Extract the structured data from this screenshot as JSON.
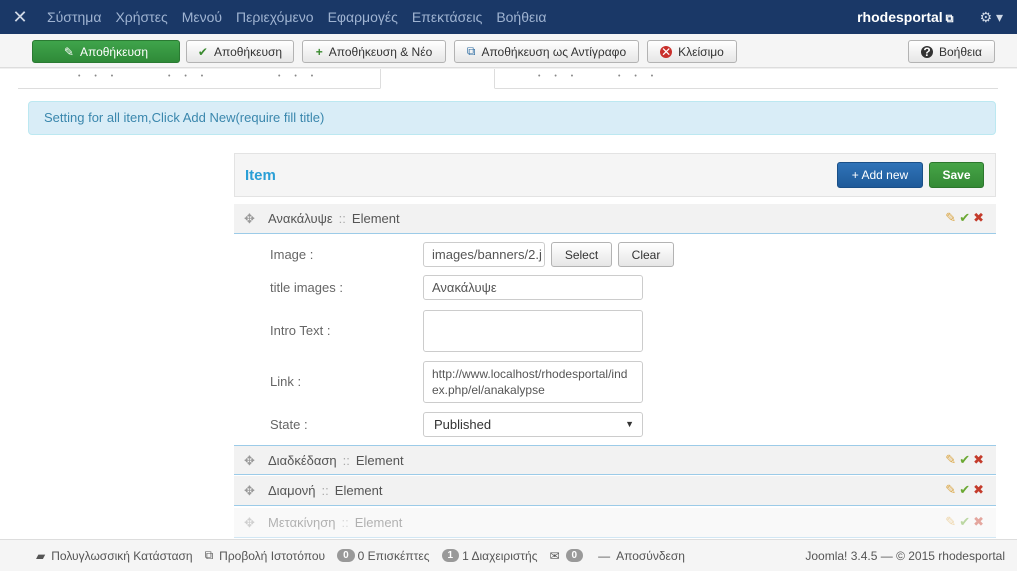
{
  "topbar": {
    "logo": "joomla-logo",
    "menu": [
      "Σύστημα",
      "Χρήστες",
      "Μενού",
      "Περιεχόμενο",
      "Εφαρμογές",
      "Επεκτάσεις",
      "Βοήθεια"
    ],
    "site_name": "rhodesportal",
    "external_icon": "external-link-icon",
    "settings_icon": "gear-icon"
  },
  "toolbar": {
    "save": "Αποθήκευση",
    "save_close": "Αποθήκευση",
    "save_new": "Αποθήκευση & Νέο",
    "save_copy": "Αποθήκευση ως Αντίγραφο",
    "close": "Κλείσιμο",
    "help": "Βοήθεια"
  },
  "alert": "Setting for all item,Click Add New(require fill title)",
  "panel": {
    "title": "Item",
    "add_new": "+ Add new",
    "save": "Save"
  },
  "items": [
    {
      "title": "Ανακάλυψε",
      "type": "Element",
      "sep": "::"
    },
    {
      "title": "Διαδκέδαση",
      "type": "Element",
      "sep": "::"
    },
    {
      "title": "Διαμονή",
      "type": "Element",
      "sep": "::"
    },
    {
      "title": "Μετακίνηση",
      "type": "Element",
      "sep": "::"
    }
  ],
  "form": {
    "image_label": "Image :",
    "image_value": "images/banners/2.j",
    "select_btn": "Select",
    "clear_btn": "Clear",
    "title_label": "title images :",
    "title_value": "Ανακάλυψε",
    "intro_label": "Intro Text :",
    "intro_value": "",
    "link_label": "Link :",
    "link_value": "http://www.localhost/rhodesportal/index.php/el/anakalypse",
    "state_label": "State :",
    "state_value": "Published"
  },
  "statusbar": {
    "multilang": "Πολυγλωσσική Κατάσταση",
    "preview": "Προβολή Ιστοτόπου",
    "visitors_count": "0",
    "visitors": "0 Επισκέπτες",
    "admins_count": "1",
    "admins": "1 Διαχειριστής",
    "messages_count": "0",
    "logout": "Αποσύνδεση",
    "copyright": "Joomla! 3.4.5 — © 2015 rhodesportal"
  }
}
